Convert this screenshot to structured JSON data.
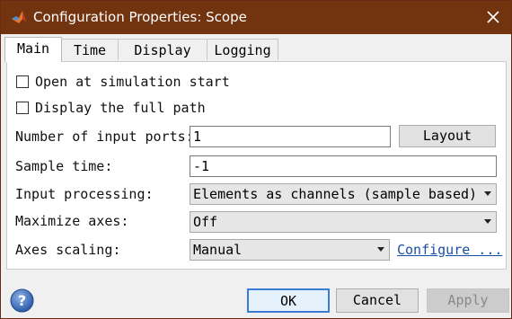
{
  "window": {
    "title": "Configuration Properties: Scope"
  },
  "tabs": [
    {
      "label": "Main",
      "active": true
    },
    {
      "label": "Time",
      "active": false
    },
    {
      "label": "Display",
      "active": false
    },
    {
      "label": "Logging",
      "active": false
    }
  ],
  "main": {
    "open_at_start": {
      "label": "Open at simulation start",
      "checked": false
    },
    "display_full_path": {
      "label": "Display the full path",
      "checked": false
    },
    "num_input_ports": {
      "label": "Number of input ports:",
      "value": "1",
      "button": "Layout"
    },
    "sample_time": {
      "label": "Sample time:",
      "value": "-1"
    },
    "input_processing": {
      "label": "Input processing:",
      "value": "Elements as channels (sample based)"
    },
    "maximize_axes": {
      "label": "Maximize axes:",
      "value": "Off"
    },
    "axes_scaling": {
      "label": "Axes scaling:",
      "value": "Manual",
      "link": "Configure ..."
    }
  },
  "footer": {
    "ok": "OK",
    "cancel": "Cancel",
    "apply": "Apply",
    "apply_enabled": false
  },
  "colors": {
    "titlebar": "#72330f",
    "link": "#1a4fa8",
    "focus": "#3a7bd5"
  },
  "icons": [
    "matlab-logo-icon",
    "close-icon",
    "help-icon",
    "dropdown-arrow-icon"
  ]
}
